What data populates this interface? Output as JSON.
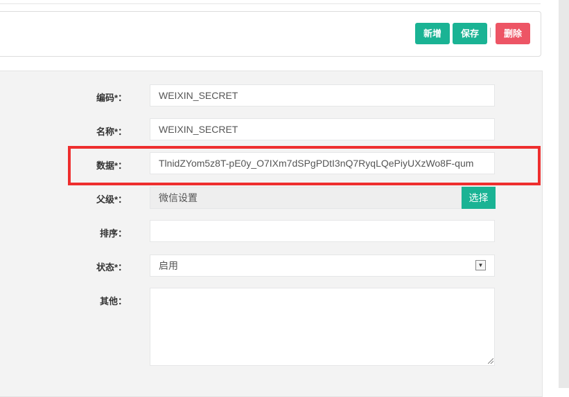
{
  "toolbar": {
    "add_label": "新增",
    "save_label": "保存",
    "delete_label": "删除"
  },
  "form": {
    "code": {
      "label": "编码*：",
      "value": "WEIXIN_SECRET"
    },
    "name": {
      "label": "名称*：",
      "value": "WEIXIN_SECRET"
    },
    "data": {
      "label": "数据*：",
      "value": "TlnidZYom5z8T-pE0y_O7IXm7dSPgPDtI3nQ7RyqLQePiyUXzWo8F-qum"
    },
    "parent": {
      "label": "父级*：",
      "value": "微信设置",
      "select_label": "选择"
    },
    "sort": {
      "label": "排序：",
      "value": ""
    },
    "status": {
      "label": "状态*：",
      "value": "启用"
    },
    "other": {
      "label": "其他：",
      "value": ""
    }
  },
  "colors": {
    "primary": "#1ab394",
    "danger": "#ed5565",
    "highlight": "#ee2e2e"
  }
}
